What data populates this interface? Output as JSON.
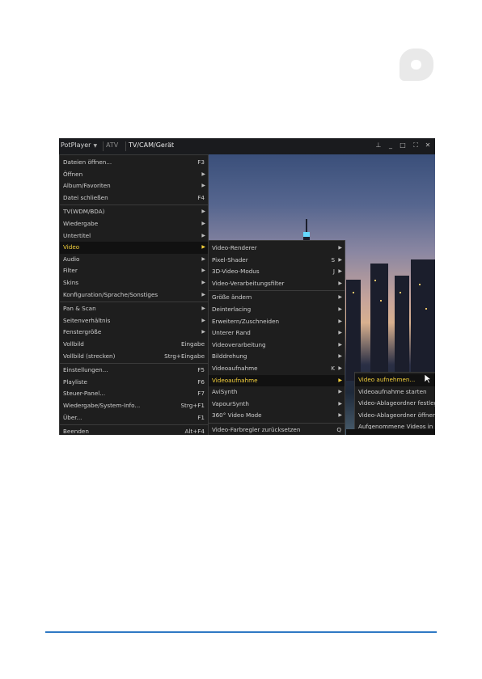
{
  "window": {
    "app": "PotPlayer",
    "tabs": [
      "ATV",
      "TV/CAM/Gerät"
    ],
    "controls": [
      "pin-icon",
      "minimize-icon",
      "maximize-icon",
      "fullscreen-icon",
      "close-icon"
    ]
  },
  "main_menu": [
    {
      "label": "Dateien öffnen...",
      "shortcut": "F3"
    },
    {
      "label": "Öffnen",
      "arrow": true
    },
    {
      "label": "Album/Favoriten",
      "arrow": true
    },
    {
      "label": "Datei schließen",
      "shortcut": "F4"
    },
    {
      "label": "TV(WDM/BDA)",
      "arrow": true
    },
    {
      "label": "Wiedergabe",
      "arrow": true
    },
    {
      "label": "Untertitel",
      "arrow": true
    },
    {
      "label": "Video",
      "arrow": true,
      "selected": true
    },
    {
      "label": "Audio",
      "arrow": true
    },
    {
      "label": "Filter",
      "arrow": true
    },
    {
      "label": "Skins",
      "arrow": true
    },
    {
      "label": "Konfiguration/Sprache/Sonstiges",
      "arrow": true
    },
    {
      "label": "Pan & Scan",
      "arrow": true
    },
    {
      "label": "Seitenverhältnis",
      "arrow": true
    },
    {
      "label": "Fenstergröße",
      "arrow": true
    },
    {
      "label": "Vollbild",
      "shortcut": "Eingabe"
    },
    {
      "label": "Vollbild (strecken)",
      "shortcut": "Strg+Eingabe"
    },
    {
      "label": "Einstellungen...",
      "shortcut": "F5"
    },
    {
      "label": "Playliste",
      "shortcut": "F6"
    },
    {
      "label": "Steuer-Panel...",
      "shortcut": "F7"
    },
    {
      "label": "Wiedergabe/System-Info...",
      "shortcut": "Strg+F1"
    },
    {
      "label": "Über...",
      "shortcut": "F1"
    },
    {
      "label": "Beenden",
      "shortcut": "Alt+F4"
    }
  ],
  "video_menu": [
    {
      "label": "Video-Renderer",
      "arrow": true
    },
    {
      "label": "Pixel-Shader",
      "shortcut": "S",
      "arrow": true
    },
    {
      "label": "3D-Video-Modus",
      "shortcut": "J",
      "arrow": true
    },
    {
      "label": "Video-Verarbeitungsfilter",
      "arrow": true
    },
    {
      "label": "Größe ändern",
      "arrow": true
    },
    {
      "label": "Deinterlacing",
      "arrow": true
    },
    {
      "label": "Erweitern/Zuschneiden",
      "arrow": true
    },
    {
      "label": "Unterer Rand",
      "arrow": true
    },
    {
      "label": "Videoverarbeitung",
      "arrow": true
    },
    {
      "label": "Bilddrehung",
      "arrow": true
    },
    {
      "label": "Videoaufnahme",
      "shortcut": "K",
      "arrow": true
    },
    {
      "label": "Videoaufnahme",
      "arrow": true,
      "selected": true
    },
    {
      "label": "AviSynth",
      "arrow": true
    },
    {
      "label": "VapourSynth",
      "arrow": true
    },
    {
      "label": "360° Video Mode",
      "arrow": true
    },
    {
      "label": "Video-Farbregler zurücksetzen",
      "shortcut": "Q"
    }
  ],
  "capture_menu": [
    {
      "label": "Video aufnehmen...",
      "selected": true
    },
    {
      "label": "Videoaufnahme starten"
    },
    {
      "label": "Video-Ablageordner festleg"
    },
    {
      "label": "Video-Ablageordner öffnen"
    },
    {
      "label": "Aufgenommene Videos in d"
    }
  ],
  "colors": {
    "accent": "#f6d23c",
    "menu_bg": "#1e1e1e",
    "footer_line": "#2f79c4"
  }
}
